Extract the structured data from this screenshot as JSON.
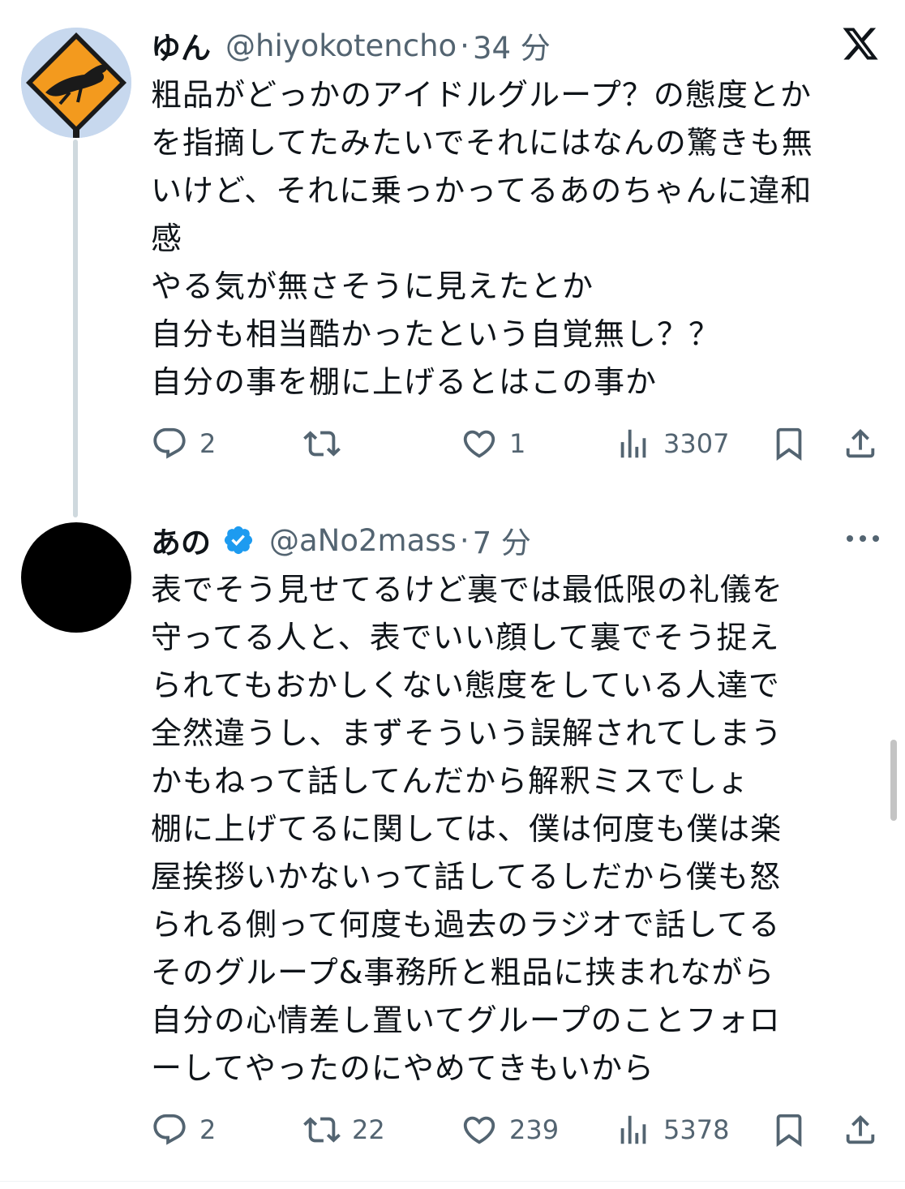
{
  "tweets": [
    {
      "display_name": "ゆん",
      "handle": "@hiyokotencho",
      "time": "34 分",
      "body": "粗品がどっかのアイドルグループ？の態度とか\nを指摘してたみたいでそれにはなんの驚きも無\nいけど、それに乗っかってるあのちゃんに違和\n感\nやる気が無さそうに見えたとか\n自分も相当酷かったという自覚無し？？\n自分の事を棚に上げるとはこの事か",
      "replies": "2",
      "retweets": "",
      "likes": "1",
      "views": "3307"
    },
    {
      "display_name": "あの",
      "handle": "@aNo2mass",
      "time": "7 分",
      "body": "表でそう見せてるけど裏では最低限の礼儀を\n守ってる人と、表でいい顔して裏でそう捉え\nられてもおかしくない態度をしている人達で\n全然違うし、まずそういう誤解されてしまう\nかもねって話してんだから解釈ミスでしょ\n棚に上げてるに関しては、僕は何度も僕は楽\n屋挨拶いかないって話してるしだから僕も怒\nられる側って何度も過去のラジオで話してる\nそのグループ&事務所と粗品に挟まれながら\n自分の心情差し置いてグループのことフォロ\nーしてやったのにやめてきもいから",
      "replies": "2",
      "retweets": "22",
      "likes": "239",
      "views": "5378"
    }
  ],
  "separator": "·",
  "colors": {
    "verified": "#1d9bf0",
    "muted": "#536471",
    "thread_line": "#cfd9de",
    "avatar_sign": "#f39a1e"
  },
  "icons": [
    "x-logo-icon",
    "reply-icon",
    "retweet-icon",
    "like-icon",
    "views-icon",
    "bookmark-icon",
    "share-icon",
    "verified-badge-icon",
    "more-options-icon"
  ]
}
